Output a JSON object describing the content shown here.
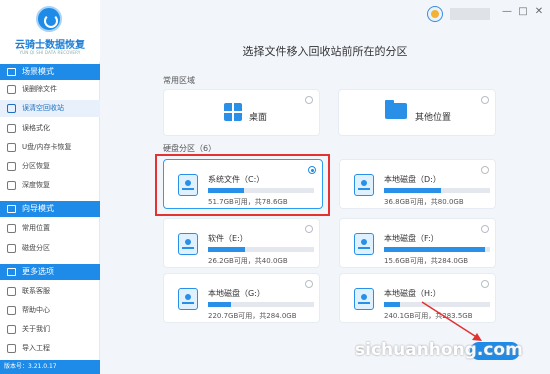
{
  "app": {
    "title": "云骑士数据恢复",
    "subtitle": "YUN QI SHI DATA RECOVERY",
    "version": "版本号：3.21.0.17"
  },
  "sidebar": {
    "sections": [
      {
        "label": "场景模式",
        "items": [
          {
            "label": "误删除文件",
            "icon": "file-icon"
          },
          {
            "label": "误清空回收站",
            "icon": "recycle-bin-icon"
          },
          {
            "label": "误格式化",
            "icon": "format-icon"
          },
          {
            "label": "U盘/内存卡恢复",
            "icon": "usb-icon"
          },
          {
            "label": "分区恢复",
            "icon": "partition-icon"
          },
          {
            "label": "深度恢复",
            "icon": "deep-scan-icon"
          }
        ]
      },
      {
        "label": "向导模式",
        "items": [
          {
            "label": "常用位置",
            "icon": "location-icon"
          },
          {
            "label": "磁盘分区",
            "icon": "disk-icon"
          }
        ]
      },
      {
        "label": "更多选项",
        "items": [
          {
            "label": "联系客服",
            "icon": "support-icon"
          },
          {
            "label": "帮助中心",
            "icon": "help-icon"
          },
          {
            "label": "关于我们",
            "icon": "info-icon"
          },
          {
            "label": "导入工程",
            "icon": "import-icon"
          }
        ]
      }
    ],
    "active_item": "误清空回收站"
  },
  "main": {
    "headline": "选择文件移入回收站前所在的分区",
    "common_label": "常用区域",
    "common": [
      {
        "label": "桌面",
        "icon": "windows-icon"
      },
      {
        "label": "其他位置",
        "icon": "folder-icon"
      }
    ],
    "disk_label": "硬盘分区（6）",
    "disks": [
      {
        "name": "系统文件（C:）",
        "stat": "51.7GB可用，共78.6GB",
        "used": 0.34,
        "selected": true
      },
      {
        "name": "本地磁盘（D:）",
        "stat": "36.8GB可用，共80.0GB",
        "used": 0.54,
        "selected": false
      },
      {
        "name": "软件（E:）",
        "stat": "26.2GB可用，共40.0GB",
        "used": 0.35,
        "selected": false
      },
      {
        "name": "本地磁盘（F:）",
        "stat": "15.6GB可用，共284.0GB",
        "used": 0.95,
        "selected": false
      },
      {
        "name": "本地磁盘（G:）",
        "stat": "220.7GB可用，共284.0GB",
        "used": 0.22,
        "selected": false
      },
      {
        "name": "本地磁盘（H:）",
        "stat": "240.1GB可用，共283.5GB",
        "used": 0.15,
        "selected": false
      }
    ]
  },
  "watermark": "sichuanhong.com",
  "colors": {
    "accent": "#1e8be8",
    "highlight": "#e23232"
  }
}
